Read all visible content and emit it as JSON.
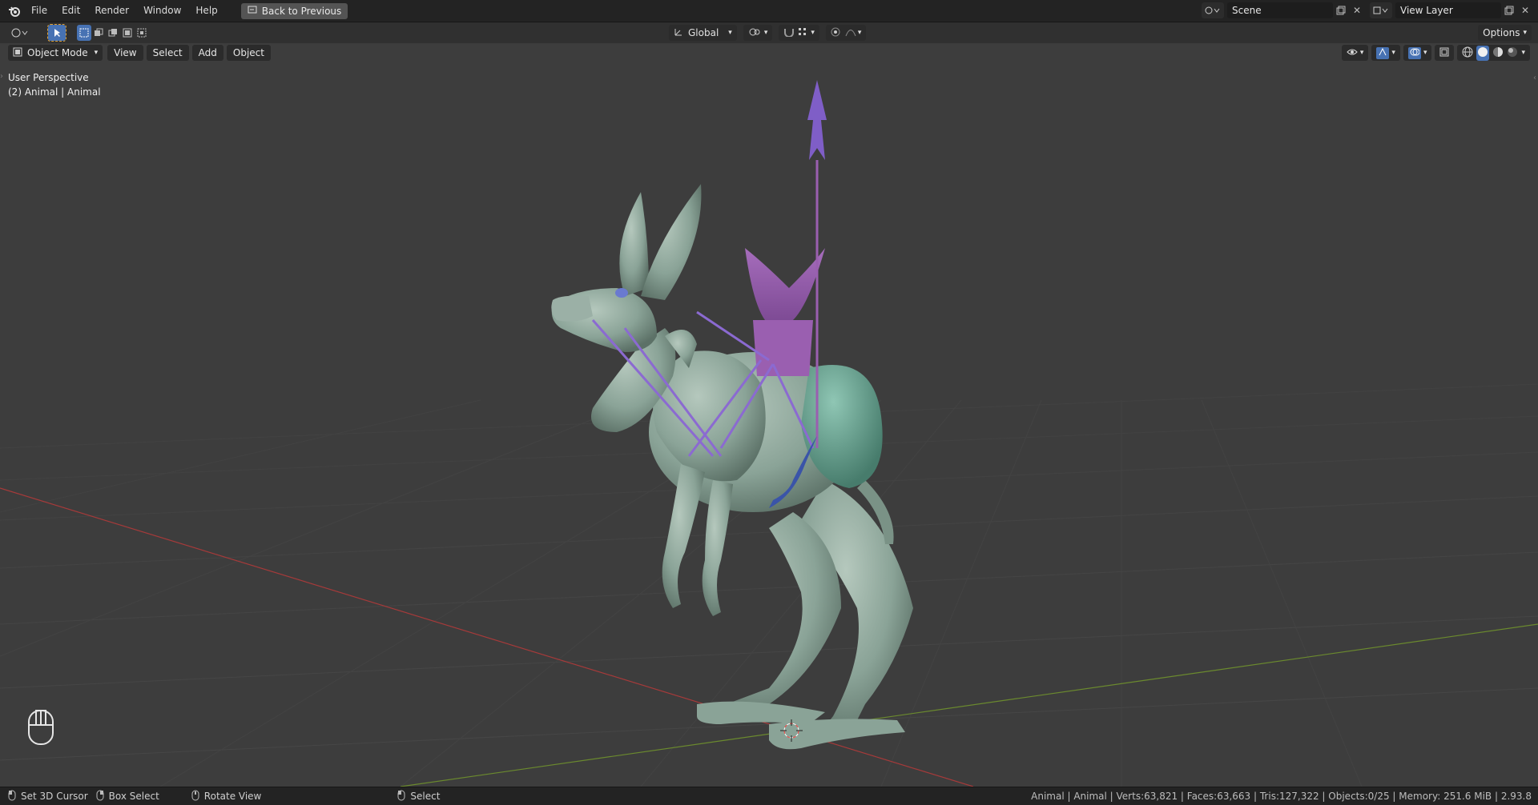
{
  "menu": {
    "items": [
      "File",
      "Edit",
      "Render",
      "Window",
      "Help"
    ],
    "back_label": "Back to Previous"
  },
  "workspace": {
    "scene_name": "Scene",
    "view_layer_name": "View Layer"
  },
  "toolbar": {
    "transform_orientation": "Global",
    "options_label": "Options"
  },
  "header3d": {
    "mode": "Object Mode",
    "items": [
      "View",
      "Select",
      "Add",
      "Object"
    ]
  },
  "viewport": {
    "perspective": "User Perspective",
    "active_object": "(2) Animal | Animal"
  },
  "statusbar": {
    "left_items": [
      {
        "icon": "mouse-left-icon",
        "label": "Set 3D Cursor"
      },
      {
        "icon": "mouse-right-icon",
        "label": "Box Select"
      },
      {
        "icon": "mouse-middle-icon",
        "label": "Rotate View"
      },
      {
        "icon": "mouse-left-icon",
        "label": "Select"
      }
    ],
    "stats": "Animal | Animal | Verts:63,821 | Faces:63,663 | Tris:127,322 | Objects:0/25 | Memory: 251.6 MiB | 2.93.8"
  },
  "colors": {
    "background": "#3d3d3d",
    "x_axis": "#a63a3a",
    "y_axis": "#6b8a2e",
    "creature": "#8aa397",
    "saddle": "#9a5fb0",
    "accent_blue": "#4772b3"
  }
}
